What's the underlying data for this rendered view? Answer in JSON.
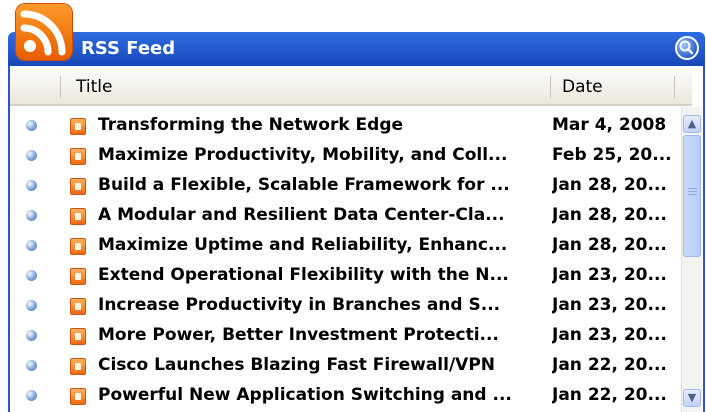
{
  "window": {
    "title": "RSS Feed",
    "icon": "rss-icon",
    "corner_button_icon": "search-icon"
  },
  "columns": {
    "title": "Title",
    "date": "Date"
  },
  "items": [
    {
      "title": "Transforming the Network Edge",
      "date": "Mar 4, 2008"
    },
    {
      "title": "Maximize Productivity, Mobility, and Coll...",
      "date": "Feb 25, 20..."
    },
    {
      "title": "Build a Flexible, Scalable Framework for ...",
      "date": "Jan 28, 20..."
    },
    {
      "title": "A Modular and Resilient Data Center-Cla...",
      "date": "Jan 28, 20..."
    },
    {
      "title": "Maximize Uptime and Reliability, Enhanc...",
      "date": "Jan 28, 20..."
    },
    {
      "title": "Extend Operational Flexibility with the N...",
      "date": "Jan 23, 20..."
    },
    {
      "title": "Increase Productivity in Branches and S...",
      "date": "Jan 23, 20..."
    },
    {
      "title": "More Power, Better Investment Protecti...",
      "date": "Jan 23, 20..."
    },
    {
      "title": "Cisco Launches Blazing Fast Firewall/VPN",
      "date": "Jan 22, 20..."
    },
    {
      "title": "Powerful New Application Switching and ...",
      "date": "Jan 22, 20..."
    }
  ],
  "colors": {
    "titlebar": "#2559d0",
    "rss_orange": "#f07a10",
    "bullet": "#6f93cf"
  }
}
